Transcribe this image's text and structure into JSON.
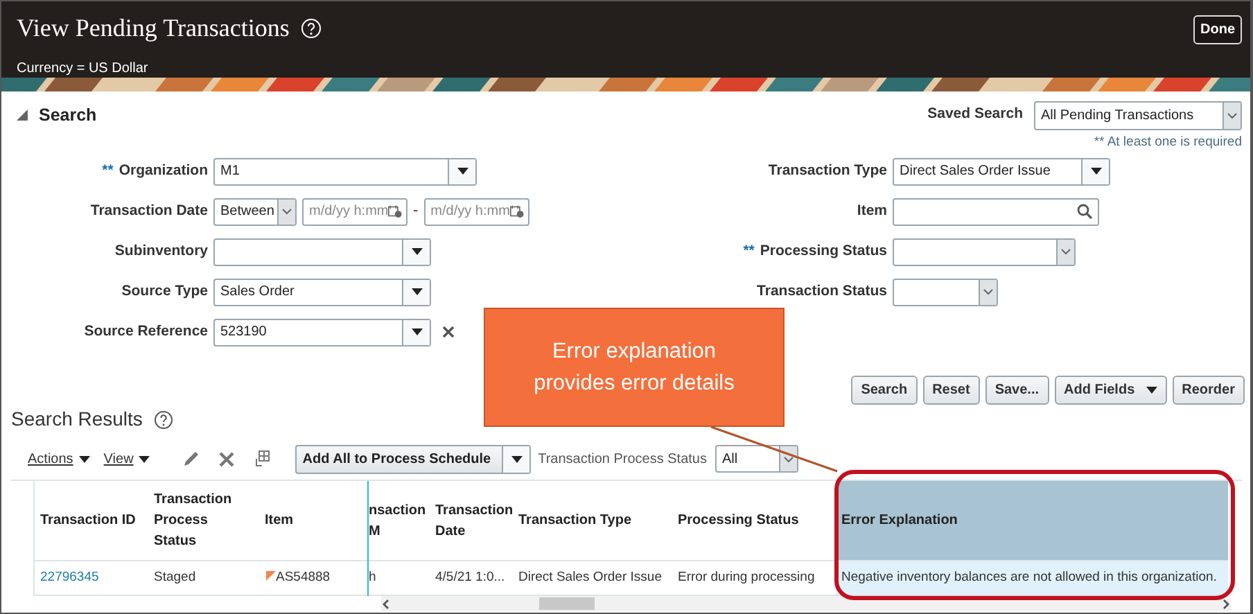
{
  "header": {
    "title": "View Pending Transactions",
    "currency": "Currency = US Dollar",
    "done_button": "Done"
  },
  "search": {
    "title": "Search",
    "expanded": true,
    "saved_search_label": "Saved Search",
    "saved_search_value": "All Pending Transactions",
    "required_note": "** At least one is required",
    "left_fields": [
      {
        "kind": "combo",
        "required_marker": "**",
        "label": "Organization",
        "value": "M1"
      },
      {
        "kind": "date_range",
        "label": "Transaction Date",
        "operator": "Between",
        "from_placeholder": "m/d/yy h:mm",
        "separator": "-",
        "to_placeholder": "m/d/yy h:mm"
      },
      {
        "kind": "combo",
        "label": "Subinventory"
      },
      {
        "kind": "combo",
        "label": "Source Type",
        "value": "Sales Order"
      },
      {
        "kind": "combo",
        "label": "Source Reference",
        "value": "523190",
        "clearable": true
      }
    ],
    "right_fields": [
      {
        "kind": "combo",
        "label": "Transaction Type",
        "value": "Direct Sales Order Issue"
      },
      {
        "kind": "search",
        "label": "Item"
      },
      {
        "kind": "select",
        "required_marker": "**",
        "label": "Processing Status"
      },
      {
        "kind": "select",
        "label": "Transaction Status"
      }
    ],
    "buttons": [
      {
        "label": "Search",
        "menu": false
      },
      {
        "label": "Reset",
        "menu": false
      },
      {
        "label": "Save...",
        "menu": false
      },
      {
        "label": "Add Fields",
        "menu": true
      },
      {
        "label": "Reorder",
        "menu": false
      }
    ]
  },
  "results": {
    "title": "Search Results",
    "menus": [
      "Actions",
      "View"
    ],
    "add_all_button": "Add All to Process Schedule",
    "status_filter_label": "Transaction Process Status",
    "status_filter_value": "All",
    "columns": [
      {
        "label": "Transaction ID",
        "highlighted": false
      },
      {
        "label": "Transaction Process Status",
        "highlighted": false
      },
      {
        "label": "Item",
        "highlighted": false
      },
      {
        "label": "nsaction M",
        "highlighted": false
      },
      {
        "label": "Transaction Date",
        "highlighted": false
      },
      {
        "label": "Transaction Type",
        "highlighted": false
      },
      {
        "label": "Processing Status",
        "highlighted": false
      },
      {
        "label": "Error Explanation",
        "highlighted": true
      }
    ],
    "rows": [
      {
        "item_flagged": true,
        "cells": [
          "22796345",
          "Staged",
          "AS54888",
          "h",
          "4/5/21 1:0...",
          "Direct Sales Order Issue",
          "Error during processing",
          "Negative inventory balances are not allowed in this organization."
        ]
      }
    ]
  },
  "callout": {
    "text": "Error explanation provides error details"
  }
}
